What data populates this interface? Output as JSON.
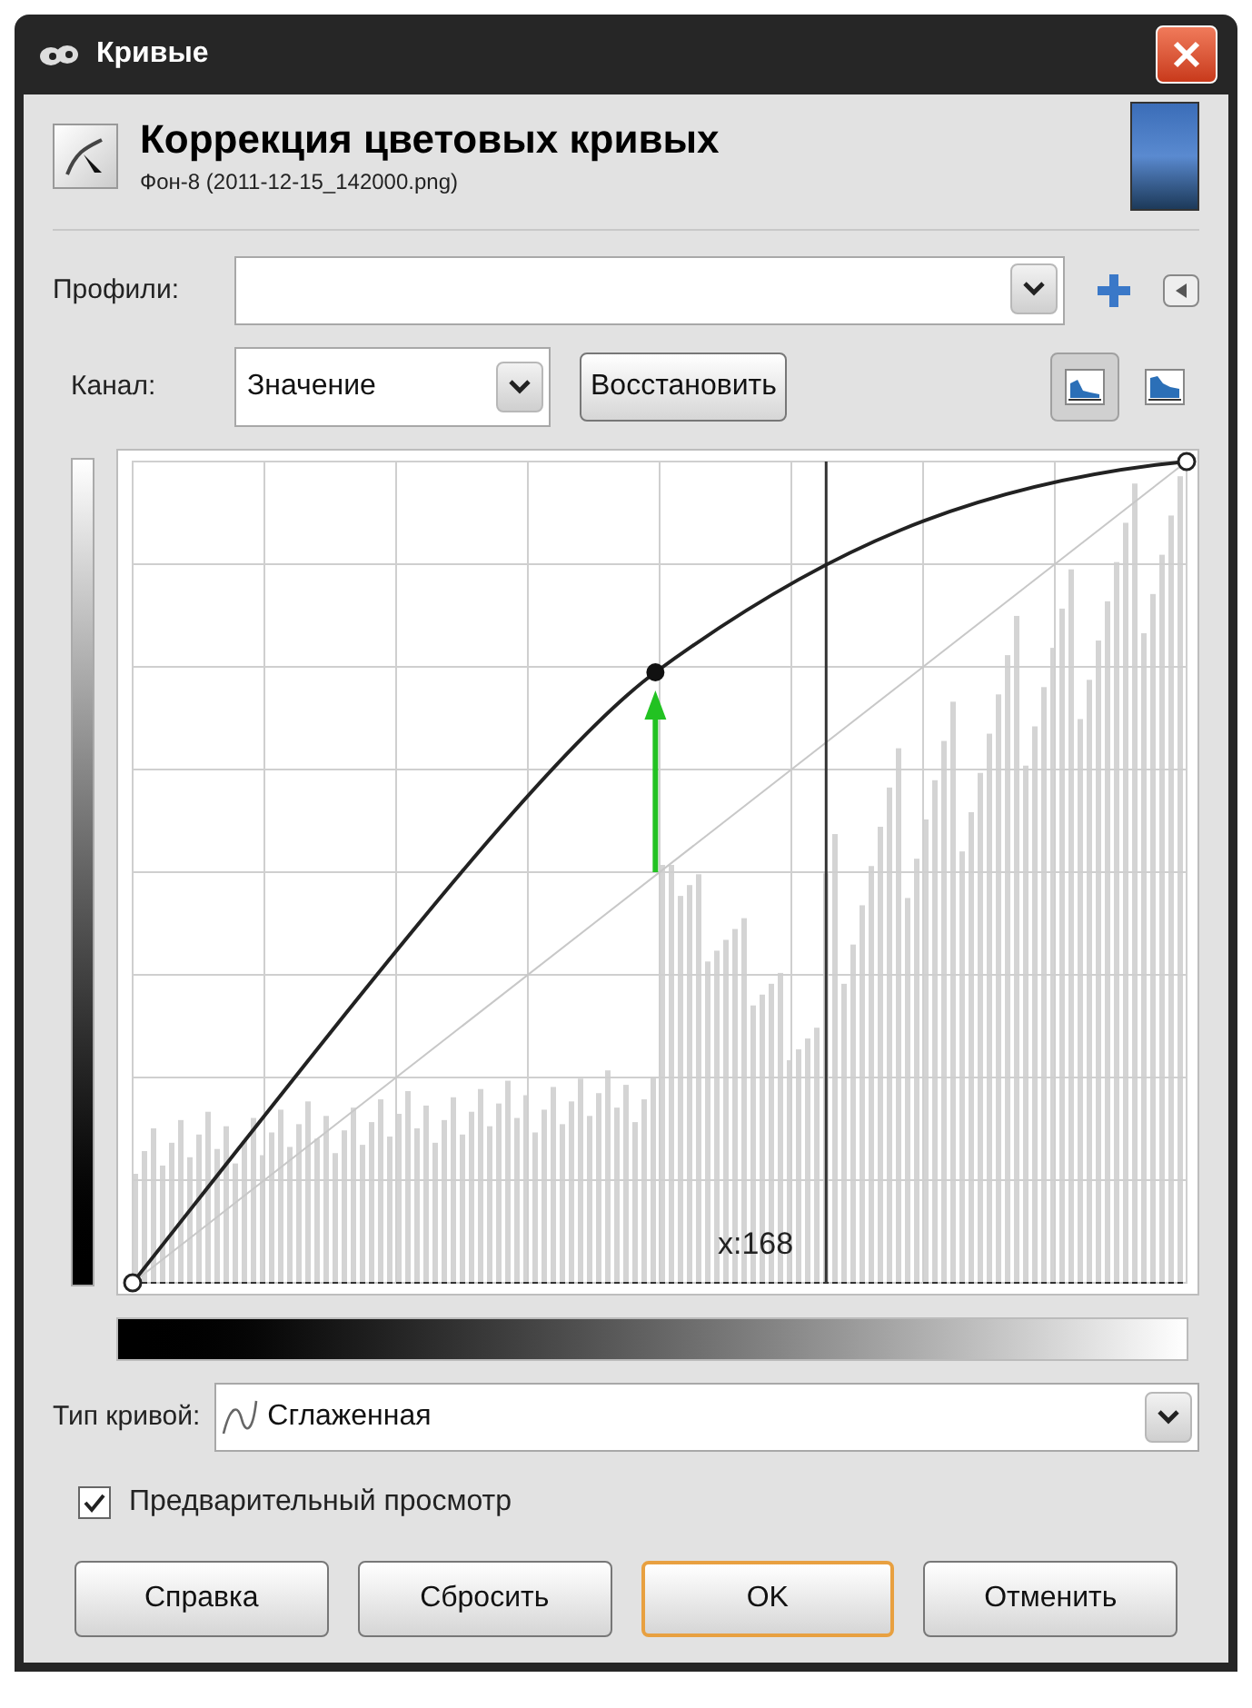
{
  "window": {
    "title": "Кривые"
  },
  "header": {
    "title": "Коррекция цветовых кривых",
    "subtitle": "Фон-8 (2011-12-15_142000.png)"
  },
  "profiles": {
    "label": "Профили:"
  },
  "channel": {
    "label": "Канал:",
    "value": "Значение",
    "reset_button": "Восстановить"
  },
  "histogram_modes": [
    {
      "selected": true
    },
    {
      "selected": false
    }
  ],
  "curve": {
    "cursor_label": "x:168"
  },
  "curve_type": {
    "label": "Тип кривой:",
    "value": "Сглаженная"
  },
  "preview": {
    "label": "Предварительный просмотр",
    "checked": true
  },
  "buttons": [
    {
      "label": "Справка",
      "default": false
    },
    {
      "label": "Сбросить",
      "default": false
    },
    {
      "label": "OK",
      "default": true
    },
    {
      "label": "Отменить",
      "default": false
    }
  ]
}
